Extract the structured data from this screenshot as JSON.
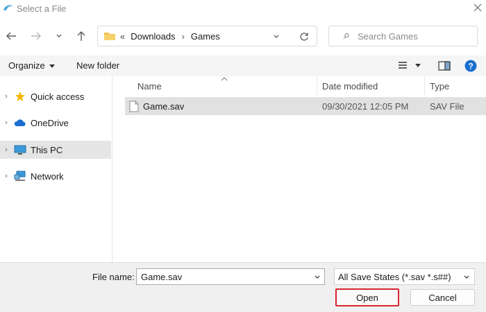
{
  "window": {
    "title": "Select a File"
  },
  "address": {
    "overflow": "«",
    "crumbs": [
      "Downloads",
      "Games"
    ],
    "separator": "›"
  },
  "search": {
    "placeholder": "Search Games"
  },
  "toolbar": {
    "organize": "Organize",
    "new_folder": "New folder"
  },
  "nav_pane": {
    "items": [
      {
        "label": "Quick access",
        "icon": "star-icon"
      },
      {
        "label": "OneDrive",
        "icon": "cloud-icon"
      },
      {
        "label": "This PC",
        "icon": "computer-icon",
        "selected": true
      },
      {
        "label": "Network",
        "icon": "network-icon"
      }
    ]
  },
  "file_list": {
    "columns": [
      "Name",
      "Date modified",
      "Type"
    ],
    "rows": [
      {
        "name": "Game.sav",
        "date": "09/30/2021 12:05 PM",
        "type": "SAV File"
      }
    ]
  },
  "footer": {
    "file_name_label": "File name:",
    "file_name_value": "Game.sav",
    "file_type": "All Save States (*.sav *.s##)",
    "open": "Open",
    "cancel": "Cancel"
  },
  "colors": {
    "highlight": "#d6262d",
    "selected_row": "#e1e1e1",
    "help": "#1a6fd1",
    "folder": "#f2c14e"
  }
}
